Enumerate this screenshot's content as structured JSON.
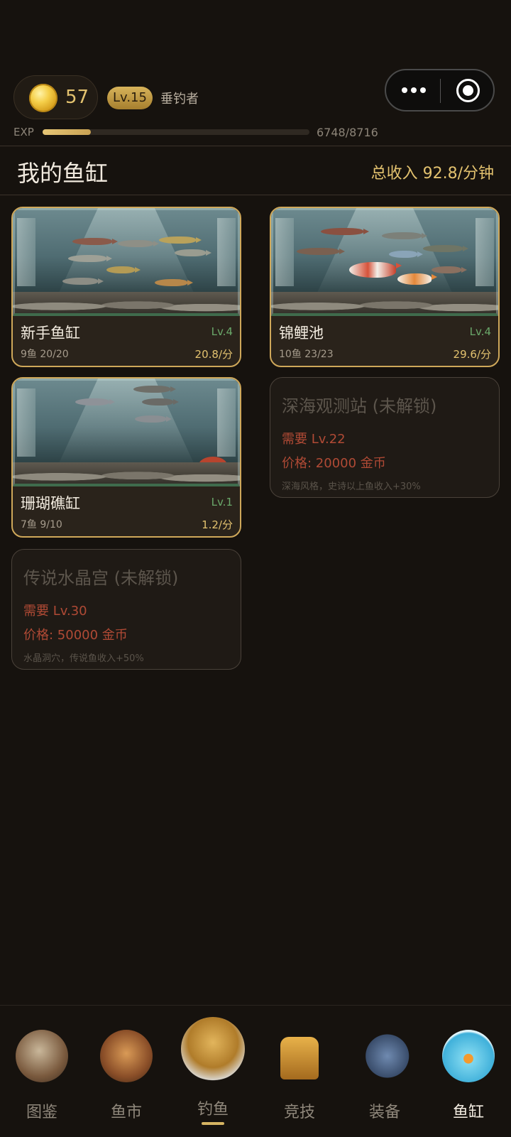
{
  "player": {
    "coins": "57",
    "level": "Lv.15",
    "title": "垂钓者",
    "exp_label": "EXP",
    "exp_value": "6748/8716",
    "exp_progress": 0.18
  },
  "header": {
    "title": "我的鱼缸",
    "total_income": "总收入 92.8/分钟"
  },
  "tanks": [
    {
      "name": "新手鱼缸",
      "level": "Lv.4",
      "meta": "9鱼 20/20",
      "rate": "20.8/分"
    },
    {
      "name": "锦鲤池",
      "level": "Lv.4",
      "meta": "10鱼 23/23",
      "rate": "29.6/分"
    },
    {
      "name": "珊瑚礁缸",
      "level": "Lv.1",
      "meta": "7鱼 9/10",
      "rate": "1.2/分"
    }
  ],
  "locked_tanks": [
    {
      "name": "深海观测站 (未解锁)",
      "requirement": "需要 Lv.22",
      "price": "价格: 20000 金币",
      "description": "深海风格，史诗以上鱼收入+30%"
    },
    {
      "name": "传说水晶宫 (未解锁)",
      "requirement": "需要 Lv.30",
      "price": "价格: 50000 金币",
      "description": "水晶洞穴，传说鱼收入+50%"
    }
  ],
  "nav": {
    "items": [
      {
        "label": "图鉴",
        "icon": "book-icon"
      },
      {
        "label": "鱼市",
        "icon": "market-icon"
      },
      {
        "label": "钓鱼",
        "icon": "fishing-icon"
      },
      {
        "label": "竞技",
        "icon": "trophy-icon"
      },
      {
        "label": "装备",
        "icon": "hook-reel-icon"
      },
      {
        "label": "鱼缸",
        "icon": "fishbowl-icon"
      }
    ],
    "active_index": 5
  },
  "colors": {
    "accent_gold": "#e3c26f",
    "level_green": "#6aa86a",
    "locked_red": "#b04a35",
    "background": "#16120e"
  }
}
